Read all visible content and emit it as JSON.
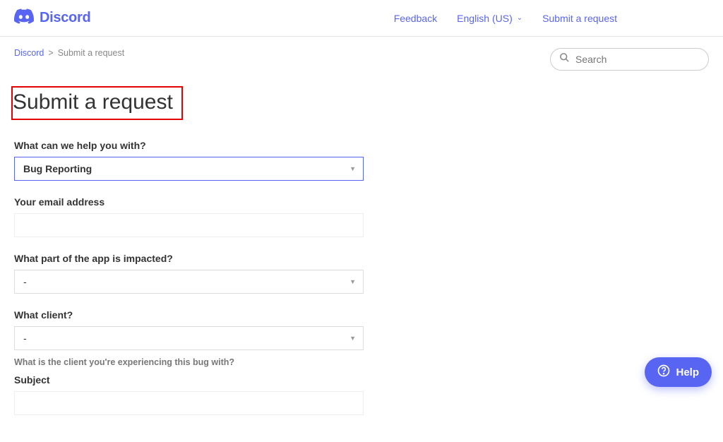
{
  "header": {
    "brand": "Discord",
    "nav": {
      "feedback": "Feedback",
      "language": "English (US)",
      "submit": "Submit a request"
    }
  },
  "breadcrumb": {
    "home": "Discord",
    "sep": ">",
    "current": "Submit a request"
  },
  "search": {
    "placeholder": "Search"
  },
  "page": {
    "title": "Submit a request"
  },
  "form": {
    "help_with": {
      "label": "What can we help you with?",
      "value": "Bug Reporting"
    },
    "email": {
      "label": "Your email address",
      "value": ""
    },
    "app_part": {
      "label": "What part of the app is impacted?",
      "value": "-"
    },
    "client": {
      "label": "What client?",
      "value": "-",
      "helper": "What is the client you're experiencing this bug with?"
    },
    "subject": {
      "label": "Subject",
      "value": ""
    }
  },
  "help_widget": {
    "label": "Help"
  }
}
